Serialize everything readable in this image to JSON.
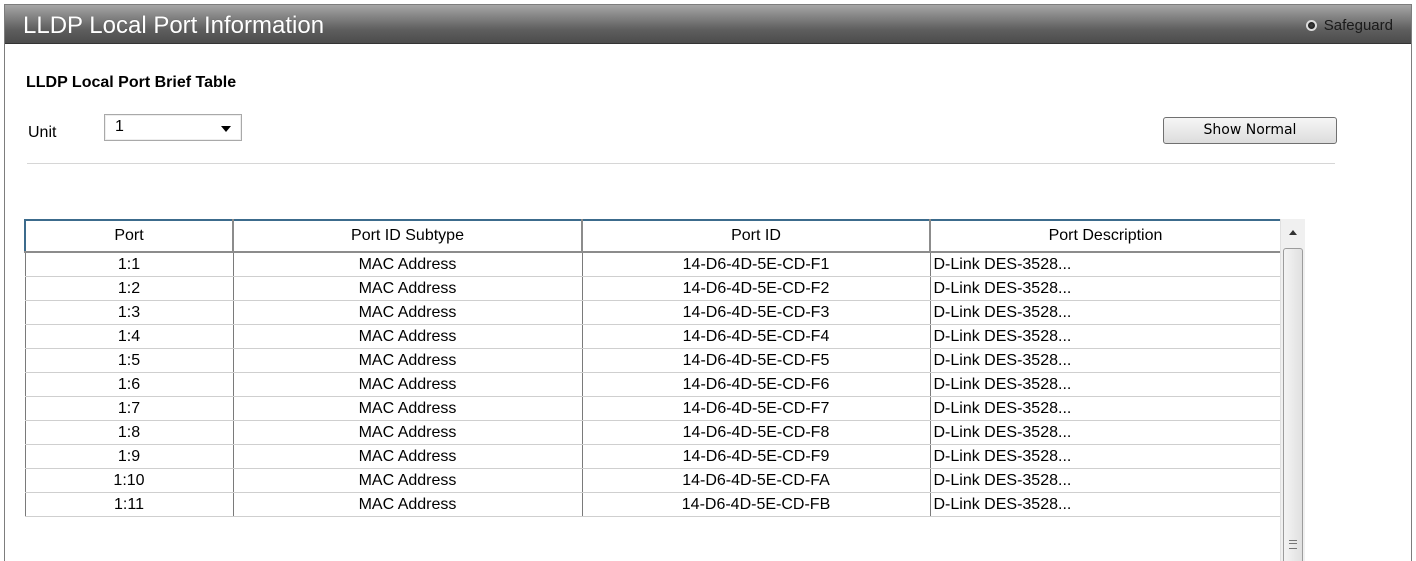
{
  "header": {
    "title": "LLDP Local Port Information",
    "safeguard_label": "Safeguard"
  },
  "section": {
    "title": "LLDP Local Port Brief Table"
  },
  "unit": {
    "label": "Unit",
    "value": "1"
  },
  "buttons": {
    "show_normal": "Show Normal"
  },
  "table": {
    "columns": [
      "Port",
      "Port ID Subtype",
      "Port ID",
      "Port Description"
    ],
    "rows": [
      [
        "1:1",
        "MAC Address",
        "14-D6-4D-5E-CD-F1",
        "D-Link DES-3528..."
      ],
      [
        "1:2",
        "MAC Address",
        "14-D6-4D-5E-CD-F2",
        "D-Link DES-3528..."
      ],
      [
        "1:3",
        "MAC Address",
        "14-D6-4D-5E-CD-F3",
        "D-Link DES-3528..."
      ],
      [
        "1:4",
        "MAC Address",
        "14-D6-4D-5E-CD-F4",
        "D-Link DES-3528..."
      ],
      [
        "1:5",
        "MAC Address",
        "14-D6-4D-5E-CD-F5",
        "D-Link DES-3528..."
      ],
      [
        "1:6",
        "MAC Address",
        "14-D6-4D-5E-CD-F6",
        "D-Link DES-3528..."
      ],
      [
        "1:7",
        "MAC Address",
        "14-D6-4D-5E-CD-F7",
        "D-Link DES-3528..."
      ],
      [
        "1:8",
        "MAC Address",
        "14-D6-4D-5E-CD-F8",
        "D-Link DES-3528..."
      ],
      [
        "1:9",
        "MAC Address",
        "14-D6-4D-5E-CD-F9",
        "D-Link DES-3528..."
      ],
      [
        "1:10",
        "MAC Address",
        "14-D6-4D-5E-CD-FA",
        "D-Link DES-3528..."
      ],
      [
        "1:11",
        "MAC Address",
        "14-D6-4D-5E-CD-FB",
        "D-Link DES-3528..."
      ]
    ]
  }
}
